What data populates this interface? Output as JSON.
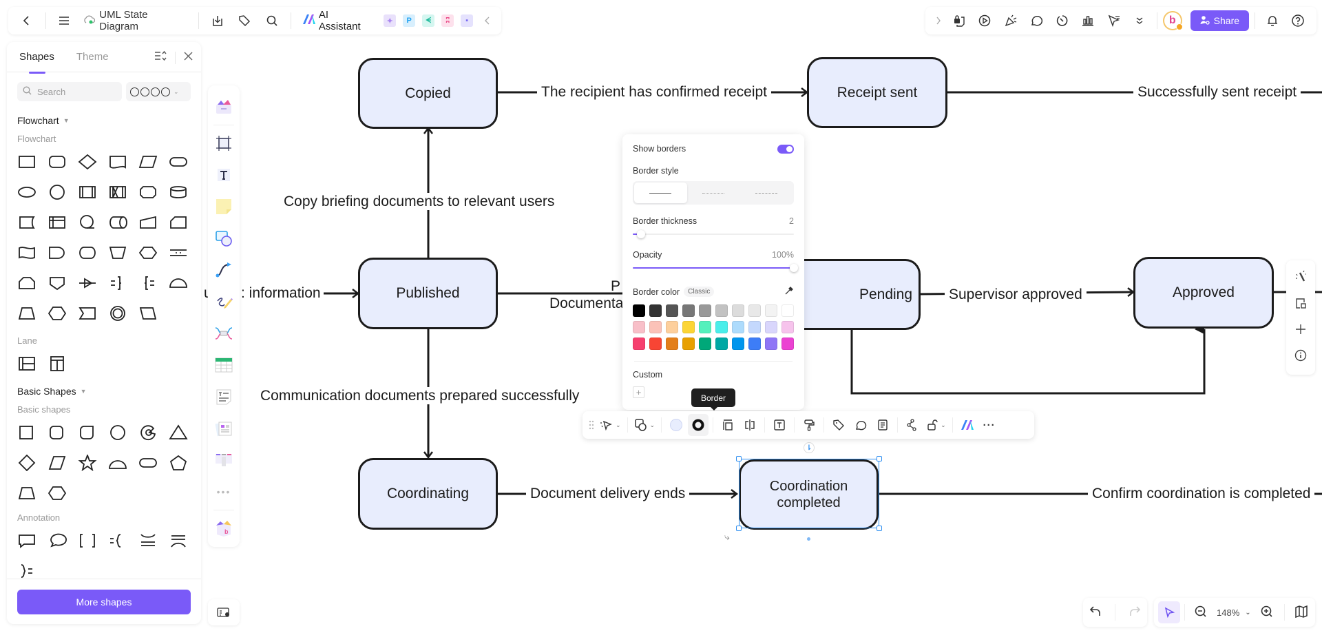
{
  "topbar": {
    "back_icon": "chevron-left-icon",
    "menu_icon": "hamburger-icon",
    "cloud_icon": "cloud-saved-icon",
    "document_title": "UML State Diagram",
    "download_icon": "download-icon",
    "tag_icon": "tag-icon",
    "search_icon": "search-icon",
    "ai_label": "AI Assistant",
    "mini_apps": [
      {
        "name": "image-ai",
        "glyph": "✦",
        "bg": "#e9e1fb",
        "fg": "#a985f0"
      },
      {
        "name": "presentation",
        "glyph": "P",
        "bg": "#d8effd",
        "fg": "#1da1f2"
      },
      {
        "name": "mindmap",
        "glyph": "ᗕ",
        "bg": "#d5f6f0",
        "fg": "#1bb99a"
      },
      {
        "name": "org-chart",
        "glyph": "ʭ",
        "bg": "#fde1ec",
        "fg": "#ea4c89"
      },
      {
        "name": "chat",
        "glyph": "▪",
        "bg": "#e5e2fd",
        "fg": "#7a6cf2"
      }
    ],
    "collapse_icon": "chevron-left-icon"
  },
  "topbar_right": {
    "expand_icon": "chevron-right-icon",
    "tools": [
      "lock-page-icon",
      "play-icon",
      "celebrate-icon",
      "comment-icon",
      "timer-icon",
      "chart-icon",
      "laser-pointer-icon",
      "more-chevrons-icon"
    ],
    "avatar_letter": "b",
    "share_label": "Share",
    "bell_icon": "bell-icon",
    "help_icon": "help-icon"
  },
  "shapes_panel": {
    "tabs": [
      "Shapes",
      "Theme"
    ],
    "active_tab": "Shapes",
    "search_placeholder": "Search",
    "sections": [
      {
        "title": "Flowchart",
        "subtitle": "Flowchart",
        "shape_count": 34
      },
      {
        "title": "",
        "subtitle": "Lane",
        "shape_count": 2
      },
      {
        "title": "Basic Shapes",
        "subtitle": "Basic shapes",
        "shape_count": 14
      },
      {
        "title": "",
        "subtitle": "Annotation",
        "shape_count": 7
      }
    ],
    "more_shapes_label": "More shapes"
  },
  "diagram": {
    "nodes": {
      "copied": "Copied",
      "receipt_sent": "Receipt sent",
      "published": "Published",
      "pending": "Pending",
      "approved": "Approved",
      "coordinating": "Coordinating",
      "coordination_completed": "Coordination completed"
    },
    "edge_labels": {
      "confirmed_receipt": "The recipient has confirmed receipt",
      "sent_receipt": "Successfully sent receipt",
      "copy_briefing": "Copy briefing documents to relevant users",
      "information": "information",
      "information_prefix": "u",
      "documenta_p": "P",
      "documenta": "Documenta",
      "supervisor_approved": "Supervisor approved",
      "comm_prepared": "Communication documents prepared successfully",
      "delivery_ends": "Document delivery ends",
      "confirm_coordination": "Confirm coordination is completed"
    }
  },
  "border_popover": {
    "show_borders_label": "Show borders",
    "show_borders_on": true,
    "border_style_label": "Border style",
    "border_styles": [
      "solid",
      "dotted",
      "dashed"
    ],
    "active_style": "solid",
    "thickness_label": "Border thickness",
    "thickness_value": "2",
    "thickness_fraction": 0.05,
    "opacity_label": "Opacity",
    "opacity_value": "100%",
    "opacity_fraction": 1.0,
    "border_color_label": "Border color",
    "palette_name": "Classic",
    "swatches": [
      "#000000",
      "#333333",
      "#555555",
      "#777777",
      "#999999",
      "#c2c2c2",
      "#dcdcdc",
      "#e8e8e8",
      "#f3f3f3",
      "#ffffff",
      "#f8bfc8",
      "#fbc2b8",
      "#fdcf9c",
      "#fcd535",
      "#55f0bc",
      "#4aeeea",
      "#addbfc",
      "#c4d8fd",
      "#d9d6fc",
      "#f6c3ec",
      "#f63f6e",
      "#f84534",
      "#e37e19",
      "#e8a000",
      "#00a879",
      "#00a8a4",
      "#0095ed",
      "#3d7df7",
      "#8f76f6",
      "#eb42d2"
    ],
    "custom_label": "Custom"
  },
  "tooltip": {
    "label": "Border"
  },
  "context_toolbar": {
    "items": [
      "drag-handle-icon",
      "ai-beautify-icon",
      "shape-swap-icon",
      "fill-color-icon",
      "border-icon",
      "align-icon",
      "flip-icon",
      "text-icon",
      "format-painter-icon",
      "tag-icon",
      "comment-icon",
      "note-icon",
      "connect-icon",
      "lock-icon",
      "ai-logo-icon",
      "more-icon"
    ],
    "fill_color": "#e8edfd"
  },
  "right_float": [
    "magic-wand-icon",
    "frame-icon",
    "add-icon",
    "info-icon"
  ],
  "bottom_right": {
    "undo_icon": "undo-icon",
    "redo_icon": "redo-icon",
    "select_icon": "select-pointer-icon",
    "zoom_out_icon": "zoom-out-icon",
    "zoom_level": "148%",
    "zoom_in_icon": "zoom-in-icon",
    "map_icon": "map-icon"
  },
  "colors": {
    "accent": "#7a5af8",
    "node_fill": "#e8edfd",
    "selection": "#2f8ff0"
  }
}
